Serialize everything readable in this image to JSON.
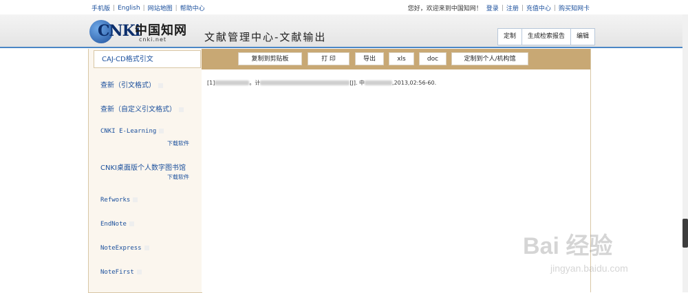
{
  "topbar": {
    "left_links": [
      "手机版",
      "English",
      "网站地图",
      "帮助中心"
    ],
    "greeting": "您好，欢迎来到中国知网！",
    "right_links": [
      "登录",
      "注册",
      "充值中心",
      "购买知网卡"
    ]
  },
  "header": {
    "logo_text": "CNKi",
    "logo_cn": "中国知网",
    "logo_url": "cnki.net",
    "title": "文献管理中心-文献输出",
    "tabs": [
      "定制",
      "生成检索报告",
      "编辑"
    ]
  },
  "sidebar": {
    "active": "CAJ-CD格式引文",
    "items": [
      {
        "label": "查新（引文格式）"
      },
      {
        "label": "查新（自定义引文格式）"
      },
      {
        "label": "CNKI E-Learning",
        "download": "下载软件"
      },
      {
        "label": "CNKI桌面版个人数字图书馆",
        "download": "下载软件"
      },
      {
        "label": "Refworks"
      },
      {
        "label": "EndNote"
      },
      {
        "label": "NoteExpress"
      },
      {
        "label": "NoteFirst"
      }
    ]
  },
  "toolbar": {
    "buttons": [
      "复制到剪贴板",
      "打 印",
      "导出",
      "xls",
      "doc",
      "定制到个人/机构馆"
    ]
  },
  "citation": {
    "prefix": "[1]",
    "seg1": "。计",
    "seg2": "[J]. 中",
    "suffix": ",2013,02:56-60."
  },
  "watermark": {
    "text": "Bai 经验",
    "url": "jingyan.baidu.com"
  }
}
